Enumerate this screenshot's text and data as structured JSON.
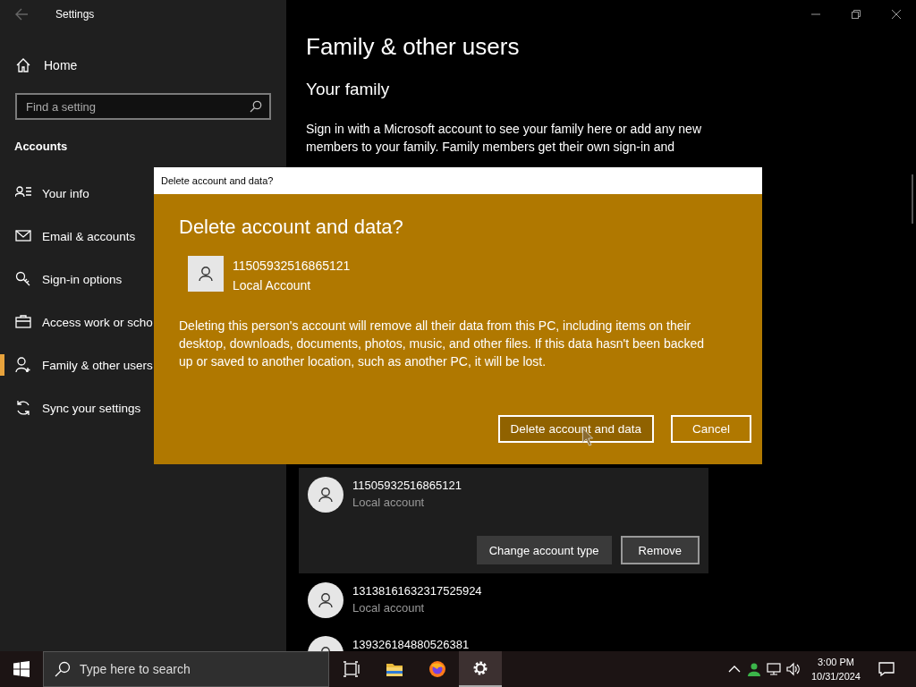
{
  "window": {
    "title": "Settings"
  },
  "sidebar": {
    "home": "Home",
    "search": {
      "placeholder": "Find a setting"
    },
    "section": "Accounts",
    "items": [
      {
        "label": "Your info",
        "selected": false
      },
      {
        "label": "Email & accounts",
        "selected": false
      },
      {
        "label": "Sign-in options",
        "selected": false
      },
      {
        "label": "Access work or scho",
        "selected": false
      },
      {
        "label": "Family & other users",
        "selected": true
      },
      {
        "label": "Sync your settings",
        "selected": false
      }
    ]
  },
  "main": {
    "title": "Family & other users",
    "subtitle": "Your family",
    "description": "Sign in with a Microsoft account to see your family here or add any new members to your family. Family members get their own sign-in and",
    "users": [
      {
        "name": "11505932516865121",
        "type": "Local account",
        "expanded": true,
        "buttons": [
          {
            "label": "Change account type",
            "focused": false
          },
          {
            "label": "Remove",
            "focused": true
          }
        ]
      },
      {
        "name": "13138161632317525924",
        "type": "Local account",
        "expanded": false
      },
      {
        "name": "139326184880526381",
        "expanded": false
      }
    ]
  },
  "dialog": {
    "title": "Delete account and data?",
    "heading": "Delete account and data?",
    "account_name": "11505932516865121",
    "account_type": "Local Account",
    "message": "Deleting this person's account will remove all their data from this PC, including items on their desktop, downloads, documents, photos, music, and other files. If this data hasn't been backed up or saved to another location, such as another PC, it will be lost.",
    "buttons": [
      {
        "label": "Delete account and data",
        "hovered": true
      },
      {
        "label": "Cancel",
        "hovered": false
      }
    ]
  },
  "taskbar": {
    "search": {
      "placeholder": "Type here to search"
    },
    "apps": [
      {
        "selected": false
      },
      {
        "selected": false
      },
      {
        "selected": false
      },
      {
        "selected": true
      }
    ],
    "time": "3:00 PM",
    "date": "10/31/2024"
  }
}
